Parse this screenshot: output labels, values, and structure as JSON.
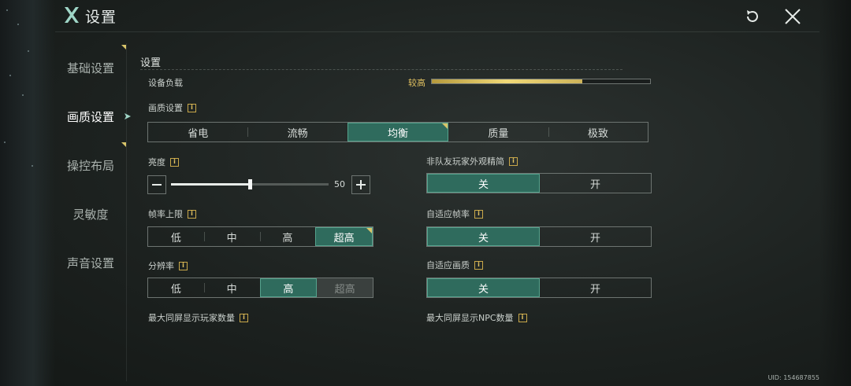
{
  "header": {
    "title": "设置",
    "logo_icon": "crossed-blades-logo",
    "reset_icon": "reset-icon",
    "close_icon": "close-icon"
  },
  "sidebar": {
    "items": [
      {
        "label": "基础设置",
        "active": false
      },
      {
        "label": "画质设置",
        "active": true
      },
      {
        "label": "操控布局",
        "active": false
      },
      {
        "label": "灵敏度",
        "active": false
      },
      {
        "label": "声音设置",
        "active": false
      }
    ]
  },
  "content": {
    "section_title": "设置",
    "device_load": {
      "label": "设备负载",
      "level_text": "较高",
      "fraction": 0.69
    },
    "quality": {
      "label": "画质设置",
      "options": [
        "省电",
        "流畅",
        "均衡",
        "质量",
        "极致"
      ],
      "selected": "均衡"
    },
    "brightness": {
      "label": "亮度",
      "value": "50",
      "fraction": 0.5
    },
    "frame_limit": {
      "label": "帧率上限",
      "options": [
        "低",
        "中",
        "高",
        "超高"
      ],
      "selected": "超高"
    },
    "resolution": {
      "label": "分辨率",
      "options": [
        "低",
        "中",
        "高",
        "超高"
      ],
      "selected": "高",
      "disabled": "超高"
    },
    "max_players": {
      "label": "最大同屏显示玩家数量"
    },
    "simplify_non_team": {
      "label": "非队友玩家外观精简",
      "off": "关",
      "on": "开",
      "selected": "关"
    },
    "adaptive_frame": {
      "label": "自适应帧率",
      "off": "关",
      "on": "开",
      "selected": "关"
    },
    "adaptive_quality": {
      "label": "自适应画质",
      "off": "关",
      "on": "开",
      "selected": "关"
    },
    "max_npc": {
      "label": "最大同屏显示NPC数量"
    },
    "info_glyph": "i"
  },
  "footer": {
    "uid": "UID: 154687855"
  },
  "colors": {
    "accent_selected": "#2f6b5d",
    "gold": "#e0c060"
  }
}
